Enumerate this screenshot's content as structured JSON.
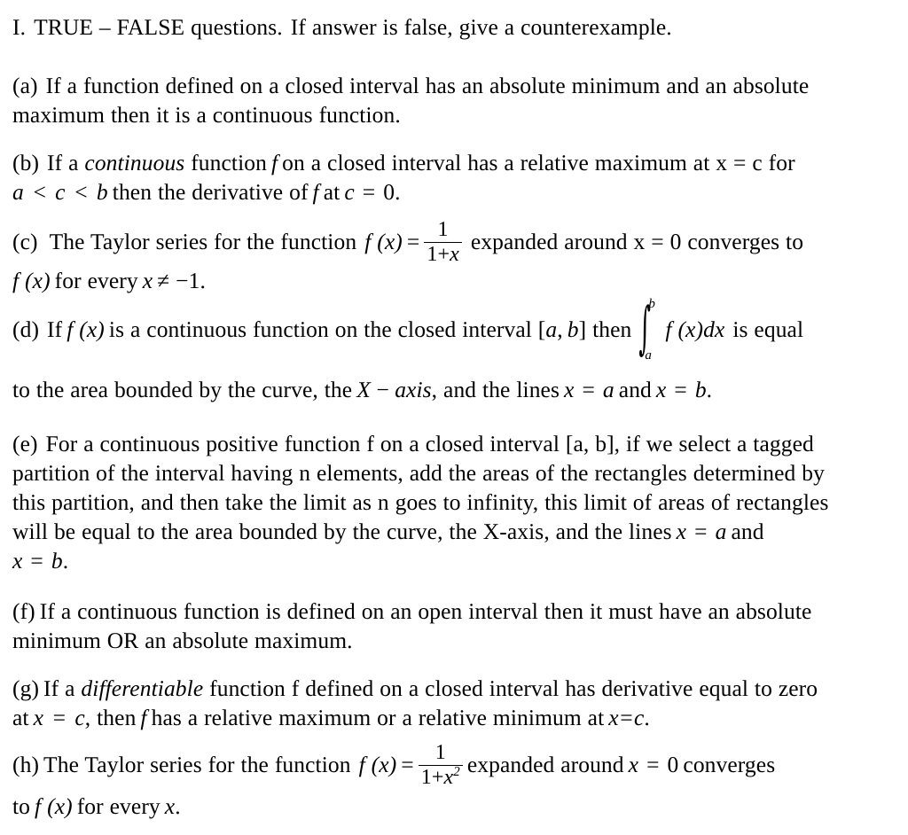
{
  "document": {
    "heading": {
      "numeral": "I.",
      "text": "TRUE – FALSE questions.",
      "text2": "If answer is false, give a counterexample."
    },
    "items": {
      "a": {
        "label": "(a)",
        "line1": "If a function defined on a closed interval has an absolute minimum and an absolute",
        "line2": "maximum then it is a continuous function."
      },
      "b": {
        "label": "(b)",
        "line1_pre": "If a",
        "line1_emph": "continuous",
        "line1_mid": "function",
        "line1_f": "f",
        "line1_post": "on a closed interval has a relative maximum at x = c for",
        "line2_a": "a",
        "line2_lt1": "<",
        "line2_c": "c",
        "line2_lt2": "<",
        "line2_b": "b",
        "line2_mid": "then the derivative of",
        "line2_f": "f",
        "line2_at": "at",
        "line2_cvar": "c",
        "line2_eq": "=",
        "line2_zero": "0."
      },
      "c": {
        "label": "(c)",
        "line1_pre": "The Taylor series for the function",
        "fx": "f (x)",
        "eq": "=",
        "frac_num": "1",
        "frac_den_one": "1+",
        "frac_den_x": "x",
        "line1_post": "expanded around x = 0 converges to",
        "line2_fx": "f (x)",
        "line2_mid": "for every",
        "line2_x": "x",
        "line2_neq": "≠ −1."
      },
      "d": {
        "label": "(d)",
        "line1_pre": "If",
        "line1_fx": "f (x)",
        "line1_mid": "is a continuous function on the closed interval [",
        "line1_a": "a",
        "line1_comma": ",",
        "line1_b": "b",
        "line1_then": "] then",
        "int_upper": "b",
        "int_lower": "a",
        "int_sign": "∫",
        "int_body_f": "f (x)",
        "int_body_dx": "dx",
        "line1_post": "is equal",
        "line2_pre": "to the area bounded by the curve, the",
        "line2_X": "X",
        "line2_minus": "−",
        "line2_axis": "axis",
        "line2_mid": ", and the lines",
        "line2_x1": "x",
        "line2_eq1": "=",
        "line2_a": "a",
        "line2_and": "and",
        "line2_x2": "x",
        "line2_eq2": "=",
        "line2_b": "b",
        "line2_period": "."
      },
      "e": {
        "label": "(e)",
        "line1": "For a continuous positive function f on a closed interval [a, b], if we select a tagged",
        "line2": "partition of the interval having n elements, add the areas of the rectangles determined by",
        "line3": "this partition, and then take the limit as n goes to infinity, this limit of areas of rectangles",
        "line4_pre": "will be equal to the area bounded by the curve, the X-axis, and the lines",
        "line4_x": "x",
        "line4_eq": "=",
        "line4_a": "a",
        "line4_and": "and",
        "line5_x": "x",
        "line5_eq": "=",
        "line5_b": "b",
        "line5_period": "."
      },
      "f": {
        "label": "(f)",
        "line1": "If a continuous function is defined on an open interval then it must have an absolute",
        "line2": "minimum OR an absolute maximum."
      },
      "g": {
        "label": "(g)",
        "line1_pre": "If a",
        "line1_emph": "differentiable",
        "line1_post": "function f defined on a closed interval has derivative equal to zero",
        "line2_at": "at",
        "line2_x": "x",
        "line2_eq": "=",
        "line2_c": "c",
        "line2_mid": ", then",
        "line2_f": "f",
        "line2_has": "has a relative maximum or a relative minimum at",
        "line2_xc": "x=c",
        "line2_period": "."
      },
      "h": {
        "label": "(h)",
        "line1_pre": "The Taylor series for the function",
        "fx": "f (x)",
        "eq": "=",
        "frac_num": "1",
        "frac_den_one": "1+",
        "frac_den_x": "x",
        "frac_den_exp": "2",
        "line1_mid": "expanded around",
        "line1_x": "x",
        "line1_eq": "=",
        "line1_zero": "0",
        "line1_post": "converges",
        "line2_pre": "to",
        "line2_fx": "f (x)",
        "line2_mid": "for every",
        "line2_x": "x",
        "line2_period": "."
      }
    }
  }
}
